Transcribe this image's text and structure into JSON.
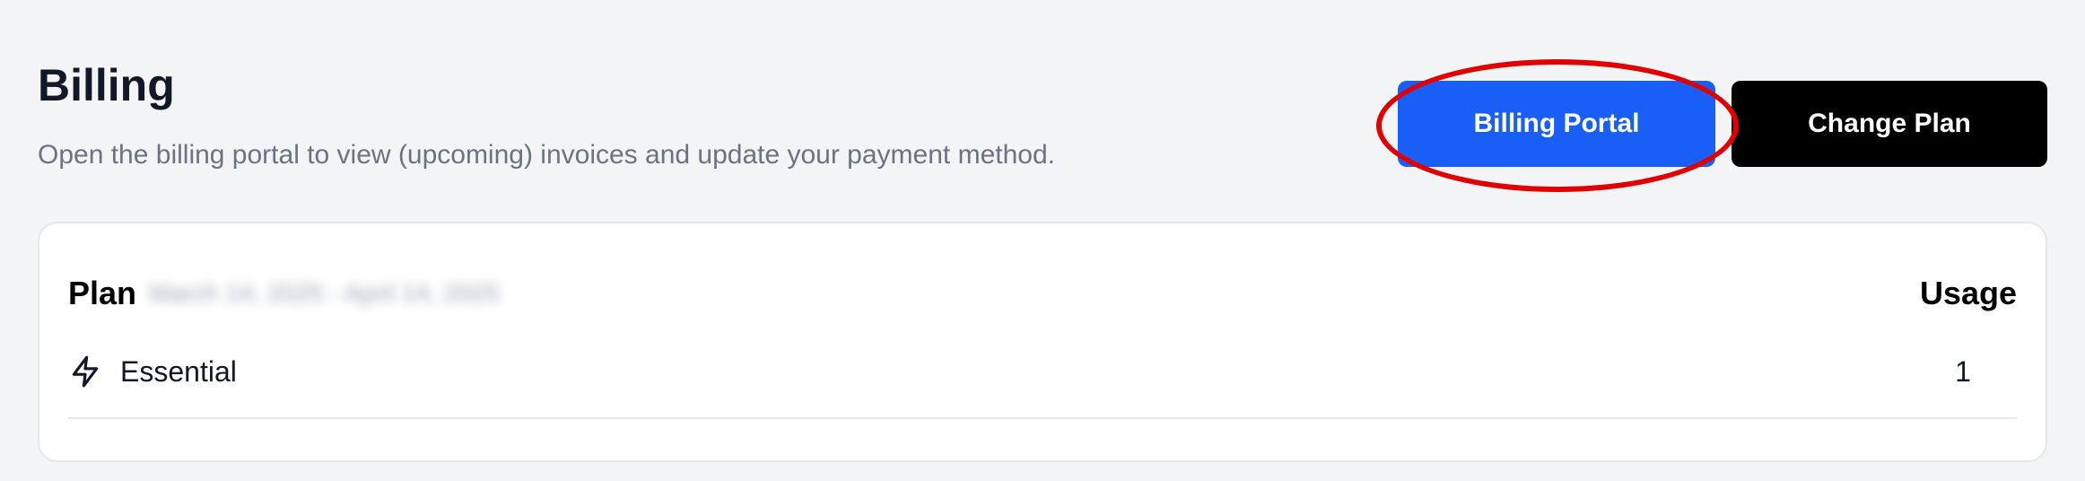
{
  "billing": {
    "title": "Billing",
    "subtitle": "Open the billing portal to view (upcoming) invoices and update your payment method."
  },
  "actions": {
    "billing_portal_label": "Billing Portal",
    "change_plan_label": "Change Plan"
  },
  "plan_table": {
    "plan_header": "Plan",
    "period_blurred": "March 14, 2025 - April 14, 2025",
    "usage_header": "Usage",
    "rows": [
      {
        "icon": "bolt-icon",
        "plan_name": "Essential",
        "usage": "1"
      }
    ]
  },
  "colors": {
    "primary_button": "#1a5ff5",
    "secondary_button": "#000000",
    "highlight_ring": "#e00000",
    "page_background": "#f3f4f6"
  }
}
